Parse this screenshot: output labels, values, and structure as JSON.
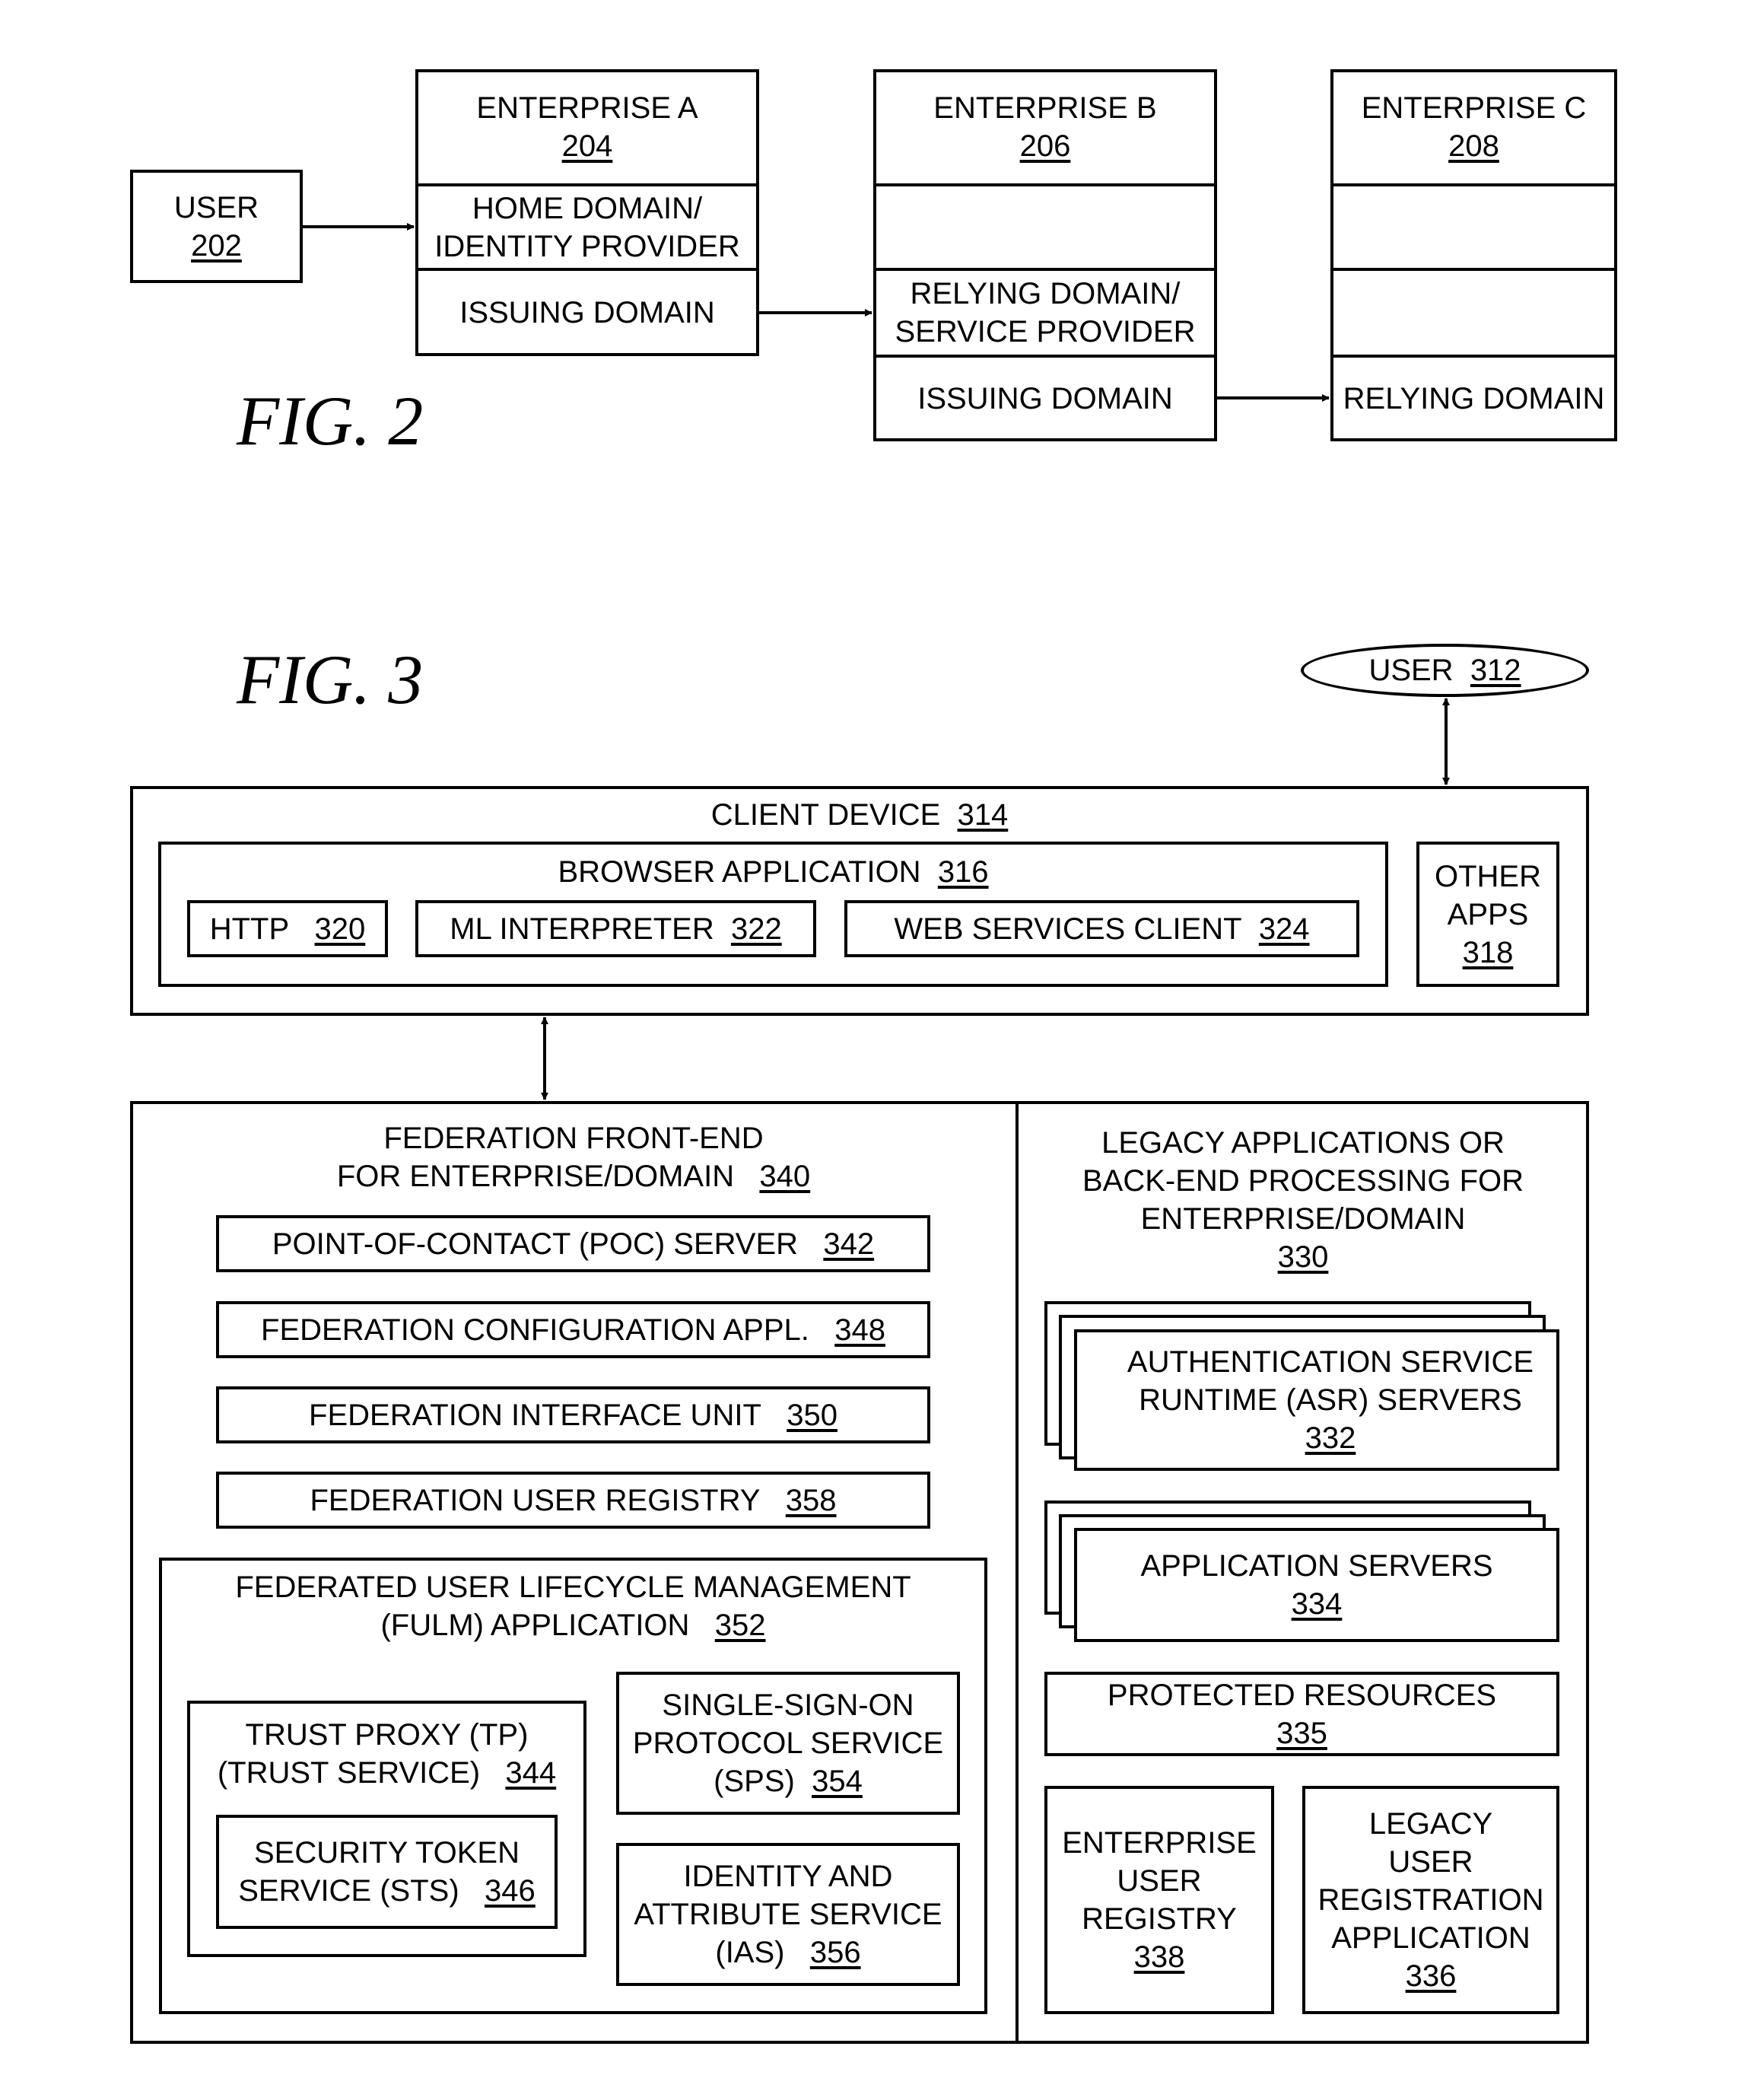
{
  "fig2": {
    "label": "FIG. 2",
    "user": {
      "name": "USER",
      "ref": "202"
    },
    "enterprise_a": {
      "name": "ENTERPRISE A",
      "ref": "204",
      "row1": [
        "HOME DOMAIN/",
        "IDENTITY PROVIDER"
      ],
      "row2": "ISSUING DOMAIN"
    },
    "enterprise_b": {
      "name": "ENTERPRISE B",
      "ref": "206",
      "row1": "",
      "row2": [
        "RELYING DOMAIN/",
        "SERVICE PROVIDER"
      ],
      "row3": "ISSUING DOMAIN"
    },
    "enterprise_c": {
      "name": "ENTERPRISE C",
      "ref": "208",
      "row1": "",
      "row2": "",
      "row3": "RELYING DOMAIN"
    }
  },
  "fig3": {
    "label": "FIG. 3",
    "user": {
      "name": "USER",
      "ref": "312"
    },
    "client_device": {
      "name": "CLIENT DEVICE",
      "ref": "314"
    },
    "browser": {
      "name": "BROWSER APPLICATION",
      "ref": "316"
    },
    "http": {
      "name": "HTTP",
      "ref": "320"
    },
    "ml": {
      "name": "ML INTERPRETER",
      "ref": "322"
    },
    "wsc": {
      "name": "WEB SERVICES CLIENT",
      "ref": "324"
    },
    "other_apps": {
      "lines": [
        "OTHER",
        "APPS"
      ],
      "ref": "318"
    },
    "front_end": {
      "lines": [
        "FEDERATION FRONT-END",
        "FOR ENTERPRISE/DOMAIN"
      ],
      "ref": "340"
    },
    "poc": {
      "name": "POINT-OF-CONTACT (POC) SERVER",
      "ref": "342"
    },
    "fca": {
      "name": "FEDERATION CONFIGURATION APPL.",
      "ref": "348"
    },
    "fiu": {
      "name": "FEDERATION INTERFACE UNIT",
      "ref": "350"
    },
    "fur": {
      "name": "FEDERATION USER REGISTRY",
      "ref": "358"
    },
    "fulm": {
      "lines": [
        "FEDERATED USER LIFECYCLE MANAGEMENT",
        "(FULM) APPLICATION"
      ],
      "ref": "352"
    },
    "tp": {
      "lines": [
        "TRUST PROXY (TP)",
        "(TRUST SERVICE)"
      ],
      "ref": "344"
    },
    "sts": {
      "lines": [
        "SECURITY TOKEN",
        "SERVICE (STS)"
      ],
      "ref": "346"
    },
    "sps": {
      "lines": [
        "SINGLE-SIGN-ON",
        "PROTOCOL SERVICE",
        "(SPS)"
      ],
      "ref": "354"
    },
    "ias": {
      "lines": [
        "IDENTITY AND",
        "ATTRIBUTE SERVICE",
        "(IAS)"
      ],
      "ref": "356"
    },
    "legacy": {
      "lines": [
        "LEGACY APPLICATIONS OR",
        "BACK-END PROCESSING FOR",
        "ENTERPRISE/DOMAIN"
      ],
      "ref": "330"
    },
    "asr": {
      "lines": [
        "AUTHENTICATION SERVICE",
        "RUNTIME (ASR) SERVERS"
      ],
      "ref": "332"
    },
    "app_servers": {
      "lines": [
        "APPLICATION SERVERS"
      ],
      "ref": "334"
    },
    "protected": {
      "lines": [
        "PROTECTED RESOURCES"
      ],
      "ref": "335"
    },
    "eur": {
      "lines": [
        "ENTERPRISE",
        "USER",
        "REGISTRY"
      ],
      "ref": "338"
    },
    "lura": {
      "lines": [
        "LEGACY",
        "USER",
        "REGISTRATION",
        "APPLICATION"
      ],
      "ref": "336"
    }
  }
}
